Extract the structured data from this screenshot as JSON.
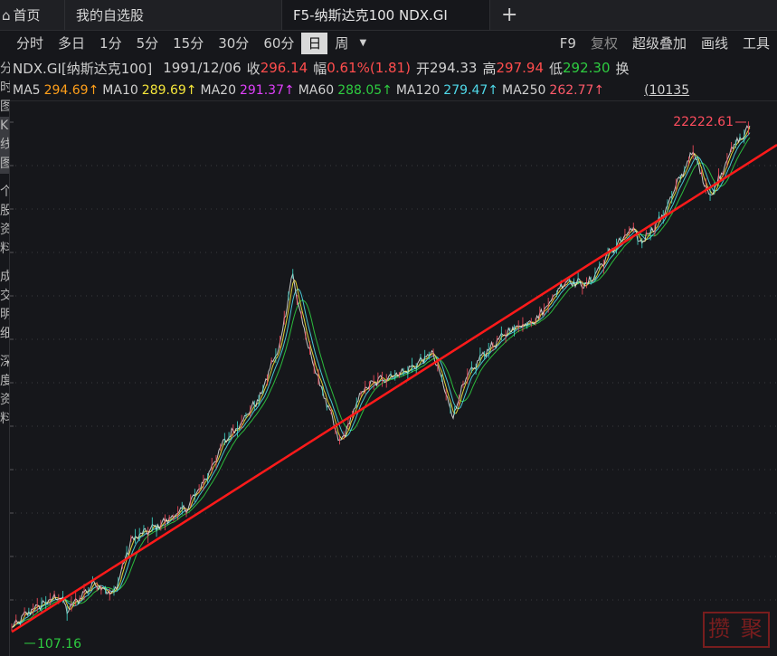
{
  "tabs": [
    {
      "label": "首页",
      "icon": "home-icon"
    },
    {
      "label": "我的自选股"
    },
    {
      "label": "F5-纳斯达克100 NDX.GI"
    },
    {
      "label": "+",
      "icon": "plus-icon"
    }
  ],
  "toolbar": {
    "periods": [
      "分时",
      "多日",
      "1分",
      "5分",
      "15分",
      "30分",
      "60分",
      "日",
      "周"
    ],
    "selected": "日",
    "right": [
      "F9",
      "复权",
      "超级叠加",
      "画线",
      "工具"
    ]
  },
  "info": {
    "code": "NDX.GI[纳斯达克100]",
    "date": "1991/12/06",
    "close_label": "收",
    "close": "296.14",
    "change_label": "幅",
    "change": "0.61%(1.81)",
    "open_label": "开",
    "open": "294.33",
    "high_label": "高",
    "high": "297.94",
    "low_label": "低",
    "low": "292.30",
    "more_label": "换"
  },
  "ma": {
    "items": [
      {
        "label": "MA5",
        "value": "294.69↑",
        "color": "#ff9f1a"
      },
      {
        "label": "MA10",
        "value": "289.69↑",
        "color": "#f5e63a"
      },
      {
        "label": "MA20",
        "value": "291.37↑",
        "color": "#e040fb"
      },
      {
        "label": "MA60",
        "value": "288.05↑",
        "color": "#2ecc40"
      },
      {
        "label": "MA120",
        "value": "279.47↑",
        "color": "#4fd8e8"
      },
      {
        "label": "MA250",
        "value": "262.77↑",
        "color": "#ff5a6a"
      }
    ],
    "extra": "(10135"
  },
  "sidebar": [
    "分",
    "时",
    "图",
    "K",
    "线",
    "图",
    "个",
    "股",
    "资",
    "料",
    "成",
    "交",
    "明",
    "细",
    "深",
    "度",
    "资",
    "料"
  ],
  "chart_data": {
    "type": "line",
    "scale": "log",
    "grid": true,
    "series_colors": {
      "price": "#e8e8e8",
      "ma_fast": "#f5e63a",
      "ma_mid": "#4fd8e8",
      "ma_slow": "#2ecc40"
    },
    "trendline_color": "#ff1a1a",
    "max_label": "22222.61",
    "min_label": "107.16",
    "ylim": [
      107.16,
      22222.61
    ],
    "x": [
      1985.0,
      1986.0,
      1987.6,
      1988.0,
      1989.5,
      1990.5,
      1991.5,
      1993.0,
      1994.5,
      1995.5,
      1996.5,
      1997.5,
      1998.5,
      1999.0,
      1999.5,
      2000.2,
      2000.9,
      2001.5,
      2002.3,
      2002.8,
      2004.0,
      2005.0,
      2006.5,
      2007.8,
      2008.4,
      2008.9,
      2009.5,
      2010.5,
      2012.0,
      2013.5,
      2015.0,
      2016.2,
      2017.5,
      2018.7,
      2019.0,
      2020.2,
      2021.9,
      2022.8,
      2023.0,
      2024.0,
      2024.6,
      2025.0
    ],
    "y": [
      125,
      150,
      175,
      150,
      200,
      175,
      310,
      360,
      430,
      575,
      840,
      1050,
      1350,
      1800,
      2200,
      4700,
      2500,
      1700,
      1100,
      820,
      1430,
      1600,
      1760,
      2100,
      1500,
      1090,
      1530,
      2050,
      2650,
      3000,
      4400,
      4200,
      6000,
      7500,
      6400,
      8300,
      16500,
      10600,
      10800,
      16900,
      19200,
      21200
    ]
  }
}
